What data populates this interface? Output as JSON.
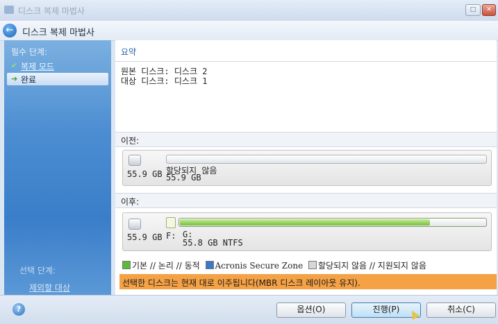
{
  "window": {
    "title": "디스크 복제 마법사",
    "restore_label": "□",
    "close_label": "✕"
  },
  "header": {
    "back_icon": "←",
    "title": "디스크 복제 마법사"
  },
  "sidebar": {
    "required_heading": "필수 단계:",
    "items": [
      {
        "label": "복제 모드",
        "mark": "✔",
        "state": "done"
      },
      {
        "label": "완료",
        "mark": "➔",
        "state": "current"
      }
    ],
    "optional_heading": "선택 단계:",
    "optional_items": [
      {
        "label": "제외할 대상"
      }
    ]
  },
  "main": {
    "section_title": "요약",
    "summary_lines": [
      "원본 디스크: 디스크 2",
      "대상 디스크: 디스크 1"
    ],
    "before": {
      "label": "이전:",
      "disk_size": "55.9 GB",
      "partition_name": "할당되지 않음",
      "partition_size": "55.9 GB"
    },
    "after": {
      "label": "이후:",
      "disk_size": "55.9 GB",
      "letter": "F:",
      "partition_name": "G:",
      "partition_size_fs": "55.8 GB  NTFS",
      "used_fraction": 0.82
    },
    "legend": {
      "basic": "기본 // 논리 // 동적",
      "acronis": "Acronis Secure Zone",
      "unallocated": "할당되지 않음 // 지원되지 않음",
      "colors": {
        "basic": "#5dbb3a",
        "acronis": "#3b78c8",
        "unallocated": "#d7d7d7"
      }
    },
    "warning": "선택한 디스크는 현재 대로 이주됩니다(MBR 디스크 레이아웃 유지)."
  },
  "buttons": {
    "options": "옵션(O)",
    "proceed": "진행(P)",
    "cancel": "취소(C)",
    "help_icon": "?"
  }
}
